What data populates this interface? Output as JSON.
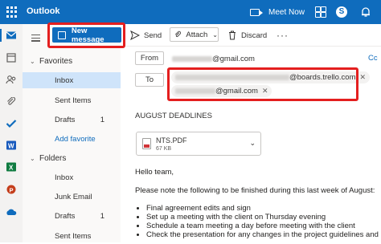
{
  "topbar": {
    "app_title": "Outlook",
    "meet_now_label": "Meet Now",
    "icons": [
      "app-launcher-icon",
      "video-camera-icon",
      "office-apps-icon",
      "skype-icon",
      "bell-icon"
    ],
    "brand_color": "#0f6cbd"
  },
  "rail": {
    "icons": [
      "mail-icon",
      "calendar-icon",
      "people-icon",
      "attach-icon",
      "todo-check-icon",
      "word-icon",
      "excel-icon",
      "powerpoint-icon",
      "onedrive-icon"
    ]
  },
  "nav": {
    "favorites_label": "Favorites",
    "favorites": [
      {
        "label": "Inbox",
        "count": "",
        "selected": true
      },
      {
        "label": "Sent Items",
        "count": ""
      },
      {
        "label": "Drafts",
        "count": "1"
      }
    ],
    "add_favorite_label": "Add favorite",
    "folders_label": "Folders",
    "folders": [
      {
        "label": "Inbox",
        "count": ""
      },
      {
        "label": "Junk Email",
        "count": ""
      },
      {
        "label": "Drafts",
        "count": "1"
      },
      {
        "label": "Sent Items",
        "count": ""
      }
    ]
  },
  "toolbar": {
    "new_message_label": "New message",
    "send_label": "Send",
    "attach_label": "Attach",
    "discard_label": "Discard",
    "more_label": "···"
  },
  "compose": {
    "from_label": "From",
    "from_value": "@gmail.com",
    "cc_label": "Cc",
    "to_label": "To",
    "recipients": [
      "@boards.trello.com",
      "@gmail.com"
    ],
    "subject": "AUGUST DEADLINES",
    "attachment": {
      "name": "NTS.PDF",
      "size": "67 KB"
    },
    "body_greeting": "Hello team,",
    "body_intro": "Please note the following to be finished during this last week of August:",
    "body_bullets": [
      "Final agreement edits and sign",
      "Set up a meeting with the client on Thursday evening",
      "Schedule a team meeting a day before meeting with the client",
      "Check the presentation for any changes in the project guidelines and"
    ]
  },
  "highlight_color": "#e41f1f"
}
